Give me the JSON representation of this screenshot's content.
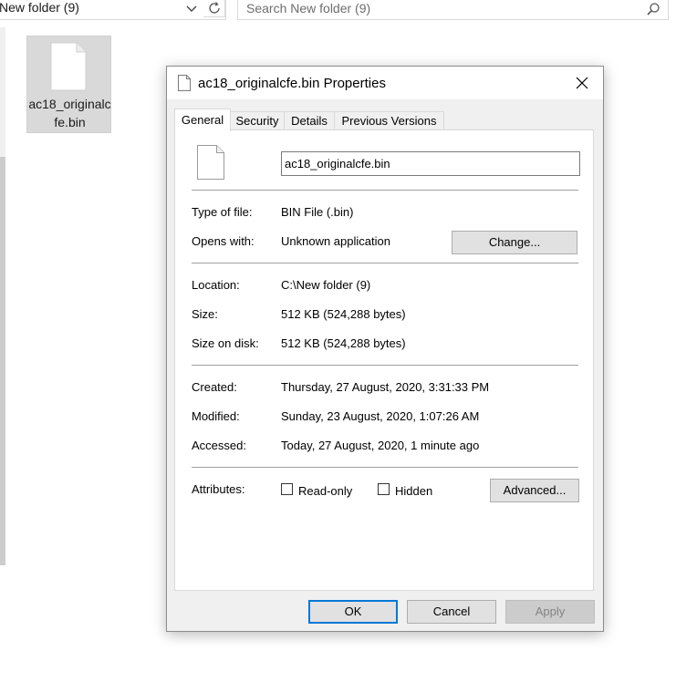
{
  "explorer": {
    "address": "New folder (9)",
    "search_placeholder": "Search New folder (9)",
    "file_name": "ac18_originalcfe.bin"
  },
  "dialog": {
    "title": "ac18_originalcfe.bin Properties",
    "tabs": [
      {
        "label": "General"
      },
      {
        "label": "Security"
      },
      {
        "label": "Details"
      },
      {
        "label": "Previous Versions"
      }
    ],
    "file_name_value": "ac18_originalcfe.bin",
    "type_label": "Type of file:",
    "type_value": "BIN File (.bin)",
    "opens_label": "Opens with:",
    "opens_value": "Unknown application",
    "change_label": "Change...",
    "location_label": "Location:",
    "location_value": "C:\\New folder (9)",
    "size_label": "Size:",
    "size_value": "512 KB (524,288 bytes)",
    "size_disk_label": "Size on disk:",
    "size_disk_value": "512 KB (524,288 bytes)",
    "created_label": "Created:",
    "created_value": "Thursday, 27 August, 2020, 3:31:33 PM",
    "modified_label": "Modified:",
    "modified_value": "Sunday, 23 August, 2020, 1:07:26 AM",
    "accessed_label": "Accessed:",
    "accessed_value": "Today, 27 August, 2020, 1 minute ago",
    "attributes_label": "Attributes:",
    "readonly_label": "Read-only",
    "hidden_label": "Hidden",
    "advanced_label": "Advanced...",
    "ok_label": "OK",
    "cancel_label": "Cancel",
    "apply_label": "Apply"
  }
}
